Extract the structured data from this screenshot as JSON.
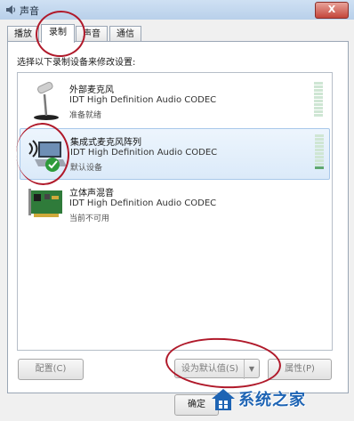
{
  "window": {
    "title": "声音",
    "close_label": "X"
  },
  "tabs": [
    {
      "label": "播放",
      "active": false
    },
    {
      "label": "录制",
      "active": true
    },
    {
      "label": "声音",
      "active": false
    },
    {
      "label": "通信",
      "active": false
    }
  ],
  "hint": "选择以下录制设备来修改设置:",
  "devices": [
    {
      "name": "外部麦克风",
      "driver": "IDT High Definition Audio CODEC",
      "status": "准备就绪",
      "icon": "microphone-icon",
      "selected": false,
      "level_fraction": 0.0
    },
    {
      "name": "集成式麦克风阵列",
      "driver": "IDT High Definition Audio CODEC",
      "status": "默认设备",
      "icon": "laptop-mic-icon",
      "selected": true,
      "level_fraction": 0.1
    },
    {
      "name": "立体声混音",
      "driver": "IDT High Definition Audio CODEC",
      "status": "当前不可用",
      "icon": "sound-card-icon",
      "selected": false,
      "level_fraction": 0.0
    }
  ],
  "buttons": {
    "configure": "配置(C)",
    "set_default": "设为默认值(S)",
    "properties": "属性(P)",
    "ok": "确定"
  },
  "watermark": {
    "text": "系统之家",
    "url": ""
  },
  "colors": {
    "accent": "#1e64b4",
    "annotation": "#b0192a",
    "meter_on": "#5fa86f"
  }
}
